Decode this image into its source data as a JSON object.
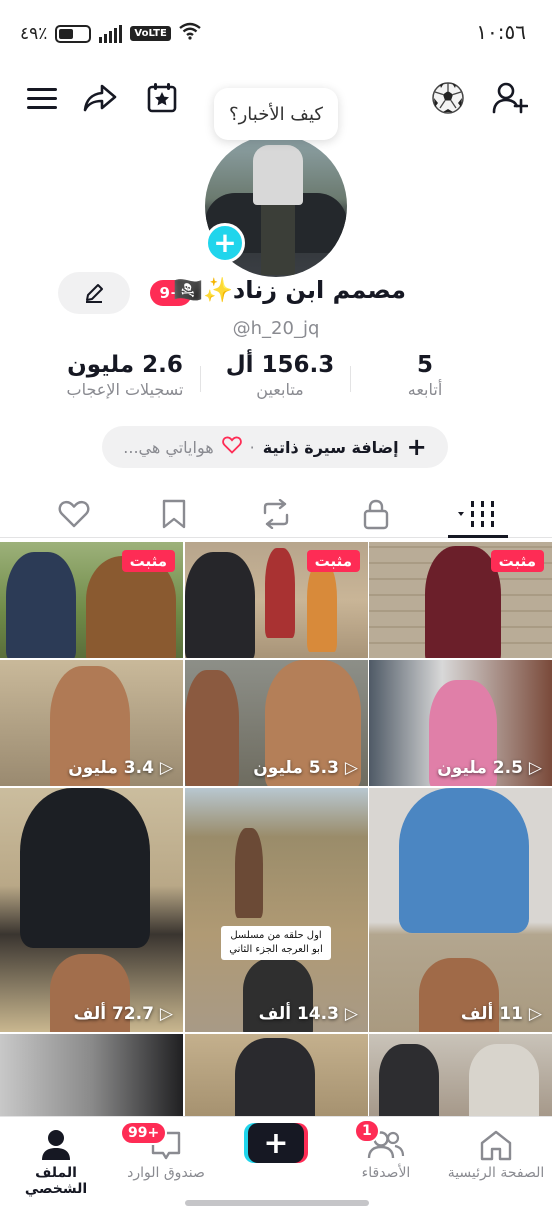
{
  "status_bar": {
    "time": "١٠:٥٦",
    "battery": "٤٩٪",
    "network_badge": "VoLTE"
  },
  "profile": {
    "bubble_text": "كيف الأخبار؟",
    "display_name": "مصمم ابن زناد✨🏴‍☠️",
    "badge": "9+",
    "handle": "@h_20_jq",
    "stats": {
      "following": {
        "value": "5",
        "label": "أتابعه"
      },
      "followers": {
        "value": "156.3 أل",
        "label": "متابعين"
      },
      "likes": {
        "value": "2.6 مليون",
        "label": "تسجيلات الإعجاب"
      }
    },
    "bio_add": "إضافة سيرة ذاتية",
    "bio_separator": "·",
    "hobbies": "هواياتي هي..."
  },
  "videos": [
    {
      "pinned": "مثبت",
      "views": ""
    },
    {
      "pinned": "مثبت",
      "views": ""
    },
    {
      "pinned": "مثبت",
      "views": ""
    },
    {
      "pinned": "",
      "views": "3.4 مليون"
    },
    {
      "pinned": "",
      "views": "5.3 مليون"
    },
    {
      "pinned": "",
      "views": "2.5 مليون"
    },
    {
      "pinned": "",
      "views": "72.7 ألف"
    },
    {
      "pinned": "",
      "views": "14.3 ألف",
      "caption": "اول حلقه من مسلسل ابو العرجه الجزء الثاني"
    },
    {
      "pinned": "",
      "views": "11 ألف"
    },
    {
      "pinned": "",
      "views": ""
    },
    {
      "pinned": "",
      "views": ""
    },
    {
      "pinned": "",
      "views": ""
    }
  ],
  "bottom_nav": {
    "home": "الصفحة الرئيسية",
    "friends": "الأصدقاء",
    "friends_badge": "1",
    "inbox": "صندوق الوارد",
    "inbox_badge": "99+",
    "profile": "الملف الشخصي",
    "create": "+"
  },
  "colors": {
    "accent_red": "#fe2c55",
    "accent_cyan": "#20d5ec",
    "text_primary": "#161823",
    "text_muted": "#8a8b91"
  }
}
